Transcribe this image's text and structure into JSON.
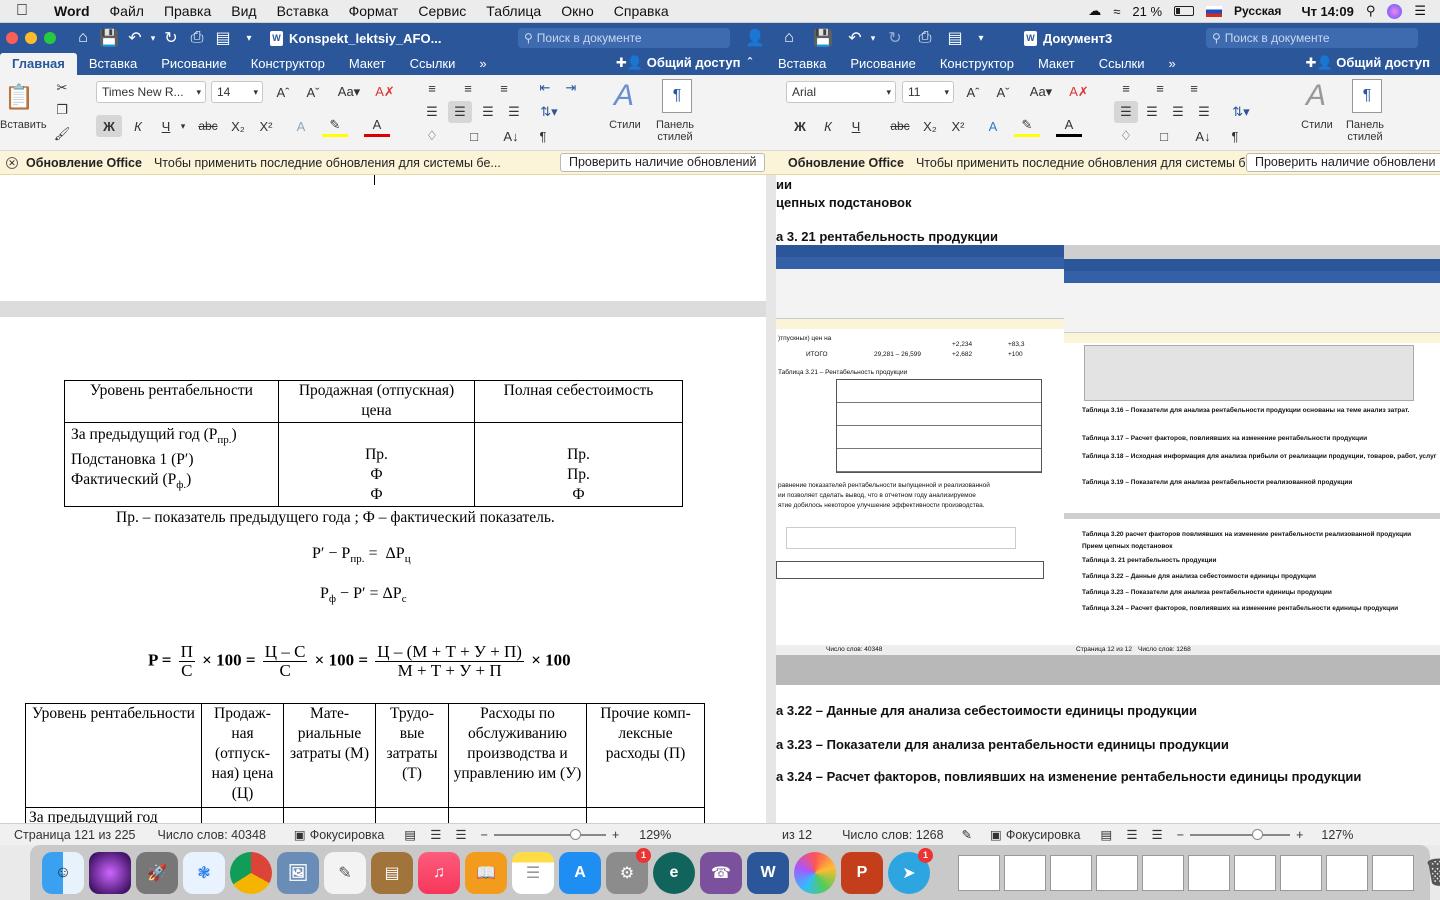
{
  "menubar": {
    "app": "Word",
    "items": [
      "Файл",
      "Правка",
      "Вид",
      "Вставка",
      "Формат",
      "Сервис",
      "Таблица",
      "Окно",
      "Справка"
    ],
    "battery": "21 %",
    "language": "Русская",
    "clock": "Чт 14:09"
  },
  "win1": {
    "doc_title": "Konspekt_lektsiy_AFO...",
    "search_placeholder": "Поиск в документе",
    "tabs": [
      "Главная",
      "Вставка",
      "Рисование",
      "Конструктор",
      "Макет",
      "Ссылки"
    ],
    "share": "Общий доступ",
    "font_name": "Times New R...",
    "font_size": "14",
    "paste_label": "Вставить",
    "styles_label": "Стили",
    "panel_label_1": "Панель",
    "panel_label_2": "стилей",
    "notify_title": "Обновление Office",
    "notify_text": "Чтобы применить последние обновления для системы бе...",
    "notify_button": "Проверить наличие обновлений",
    "status_page": "Страница 121 из 225",
    "status_words": "Число слов: 40348",
    "status_focus": "Фокусировка",
    "zoom": "129%"
  },
  "win2": {
    "doc_title": "Документ3",
    "search_placeholder": "Поиск в документе",
    "tabs": [
      "Вставка",
      "Рисование",
      "Конструктор",
      "Макет",
      "Ссылки"
    ],
    "share": "Общий доступ",
    "font_name": "Arial",
    "font_size": "11",
    "styles_label": "Стили",
    "panel_label_1": "Панель",
    "panel_label_2": "стилей",
    "notify_title": "Обновление Office",
    "notify_text": "Чтобы применить последние обновления для системы б...",
    "notify_button": "Проверить наличие обновлени",
    "status_page": "из 12",
    "status_words": "Число слов: 1268",
    "status_focus": "Фокусировка",
    "zoom": "127%",
    "headings_top": [
      "ии",
      "цепных подстановок",
      "а 3. 21 рентабельность продукции"
    ],
    "headings_bottom": [
      "а 3.22 – Данные для анализа себестоимости единицы продукции",
      "а 3.23 – Показатели для анализа рентабельности единицы продукции",
      "а 3.24 – Расчет факторов, повлиявших на изменение рентабельности единицы продукции"
    ],
    "inner": {
      "rows": [
        "+2,234",
        "+83,3",
        "ИТОГО",
        "29,281 – 26,599",
        "+2,682",
        "+100"
      ],
      "table_title": "Таблица 3.21 – Рентабельность продукции",
      "lines": [
        "Таблица 3.16 – Показатели для анализа рентабельности продукции основаны на теме анализ затрат.",
        "Таблица 3.17 – Расчет факторов, повлиявших на изменение рентабельности продукции",
        "Таблица 3.18 – Исходная информация для анализа прибыли от реализации продукции, товаров, работ, услуг",
        "Таблица 3.19 – Показатели для анализа рентабельности реализованной продукции",
        "Таблица 3.20 расчет факторов повлиявших на изменение рентабельности реализованной продукции",
        "Прием цепных подстановок",
        "Таблица 3. 21 рентабельность продукции",
        "Таблица 3.22 – Данные для анализа себестоимости единицы продукции",
        "Таблица 3.23 – Показатели для анализа рентабельности единицы продукции",
        "Таблица 3.24 – Расчет факторов, повлиявших на изменение рентабельности единицы продукции"
      ],
      "mini_status_1": "Число слов: 40348",
      "mini_status_2": "Страница 12 из 12",
      "mini_status_3": "Число слов: 1268"
    }
  },
  "table1": {
    "headers": [
      "Уровень рентабельности",
      "Продажная (отпускная) цена",
      "Полная себестоимость"
    ],
    "rows": [
      "За предыдущий год (Pпр.)",
      "Подстановка 1 (P′)",
      "Фактический (Pф.)"
    ],
    "col2": [
      "Пр.",
      "Ф",
      "Ф"
    ],
    "col3": [
      "Пр.",
      "Пр.",
      "Ф"
    ]
  },
  "note": "Пр. – показатель предыдущего года ; Ф – фактический показатель.",
  "formulas": {
    "f1": "P′ – Pпр. = ΔPц",
    "f2": "Pф – P′ = ΔPс",
    "main_lhs": "P =",
    "n1": "П",
    "d1": "С",
    "times100": "× 100 =",
    "n2": "Ц – С",
    "d2": "С",
    "n3": "Ц – (М + Т + У + П)",
    "d3": "М + Т + У + П",
    "tail": "× 100"
  },
  "table2": {
    "headers": [
      "Уровень рентабельности",
      "Продаж-ная (отпуск-ная) цена (Ц)",
      "Мате-риальные затраты (М)",
      "Трудо-вые затраты (Т)",
      "Расходы по обслуживанию производства и управлению им (У)",
      "Прочие комп-лексные расходы (П)"
    ],
    "first_row": "За предыдущий год"
  },
  "colors": {
    "word_blue": "#2b579a",
    "notify_bg": "#fcf4d8"
  }
}
